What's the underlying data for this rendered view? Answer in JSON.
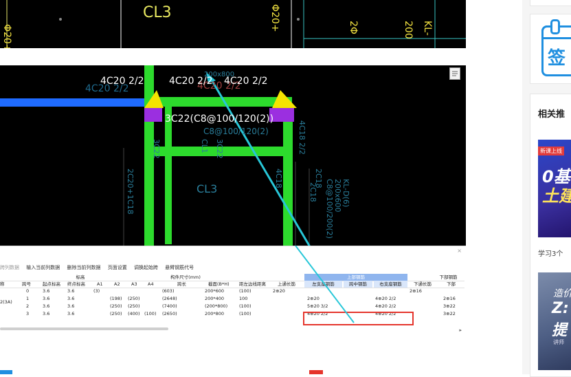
{
  "cad_top": {
    "labels": [
      "Φ20+1Φ",
      "CL3",
      "Φ20+",
      "KL-",
      "200",
      "2Φ"
    ]
  },
  "cad_main": {
    "top_left_label": "4C20 2/2",
    "top_mid_label": "4C20 2/2",
    "top_right_label": "4C20 2/2",
    "ghost_label_1": "4C20 2/2",
    "ghost_label_2": "200x800",
    "ghost_label_3": "4C20 2/2",
    "beam_label": "3C22(C8@100/120(2))",
    "ghost_beam_label": "C8@100/120(2)",
    "vertical_labels": [
      "3C22",
      "CL1",
      "3C22",
      "2C20+1C18",
      "4C18 2/2",
      "2C18",
      "KL-D(6)",
      "200x600",
      "C8@100/200(2)",
      "2C18",
      "4C18"
    ],
    "cl3_label": "CL3"
  },
  "grid_toolbar": {
    "items": [
      "跨列数据",
      "输入当前列数据",
      "删除当前列数据",
      "页面设置",
      "调换起始跨",
      "悬臂钢筋代号"
    ]
  },
  "grid": {
    "group_headers": {
      "elevation": "标高",
      "size": "构件尺寸(mm)",
      "top_rebar": "上部钢筋",
      "bottom_rebar": "下部钢筋"
    },
    "col_headers": [
      "称",
      "跨号",
      "起点标高",
      "终点标高",
      "A1",
      "A2",
      "A3",
      "A4",
      "跨长",
      "截面(B*H)",
      "距左边线距离",
      "上通长筋",
      "左支座钢筋",
      "跨中钢筋",
      "右支座钢筋",
      "下通长筋",
      "下部"
    ],
    "rows": [
      {
        "name": "",
        "span": "0",
        "start": "3.6",
        "end": "3.6",
        "a1": "(3)",
        "a2": "",
        "a3": "",
        "a4": "",
        "len": "(603)",
        "section": "200*600",
        "dist": "(100)",
        "top_cont": "2⊕20",
        "left_sup": "",
        "mid": "",
        "right_sup": "",
        "bot_cont": "2⊕16",
        "bottom": ""
      },
      {
        "name": "2(3A)",
        "span": "1",
        "start": "3.6",
        "end": "3.6",
        "a1": "",
        "a2": "(198)",
        "a3": "(250)",
        "a4": "",
        "len": "(2648)",
        "section": "200*400",
        "dist": "100",
        "top_cont": "",
        "left_sup": "2⊕20",
        "mid": "",
        "right_sup": "4⊕20 2/2",
        "bot_cont": "",
        "bottom": "2⊕16"
      },
      {
        "name": "",
        "span": "2",
        "start": "3.6",
        "end": "3.6",
        "a1": "",
        "a2": "(250)",
        "a3": "(250)",
        "a4": "",
        "len": "(7400)",
        "section": "(200*800)",
        "dist": "(100)",
        "top_cont": "",
        "left_sup": "5⊕20 3/2",
        "mid": "",
        "right_sup": "4⊕20 2/2",
        "bot_cont": "",
        "bottom": "3⊕22"
      },
      {
        "name": "",
        "span": "3",
        "start": "3.6",
        "end": "3.6",
        "a1": "",
        "a2": "(250)",
        "a3": "(400)",
        "a4": "(100)",
        "len": "(2650)",
        "section": "200*800",
        "dist": "(100)",
        "top_cont": "",
        "left_sup": "4⊕20 2/2",
        "mid": "",
        "right_sup": "4⊕20 2/2",
        "bot_cont": "",
        "bottom": "3⊕22"
      }
    ]
  },
  "sidebar": {
    "sign_label": "签",
    "related_title": "相关推",
    "promo1_badge": "新课上线",
    "promo1_title_1": "0基",
    "promo1_title_2": "土建",
    "caption": "学习3个",
    "promo2_line1": "造价",
    "promo2_line2": "Z:",
    "promo2_line3": "提",
    "promo2_footer": "讲师"
  },
  "colors": {
    "cad_bg": "#000000",
    "beam_green": "#2ddb2d",
    "support_yellow": "#f5e400",
    "support_purple": "#9b2fe0",
    "beam_blue": "#1f6bff",
    "arrow_cyan": "#28c7d8",
    "red_highlight": "#e5342b",
    "header_blue": "#8fb5ee",
    "accent_blue": "#1f8fe0"
  }
}
